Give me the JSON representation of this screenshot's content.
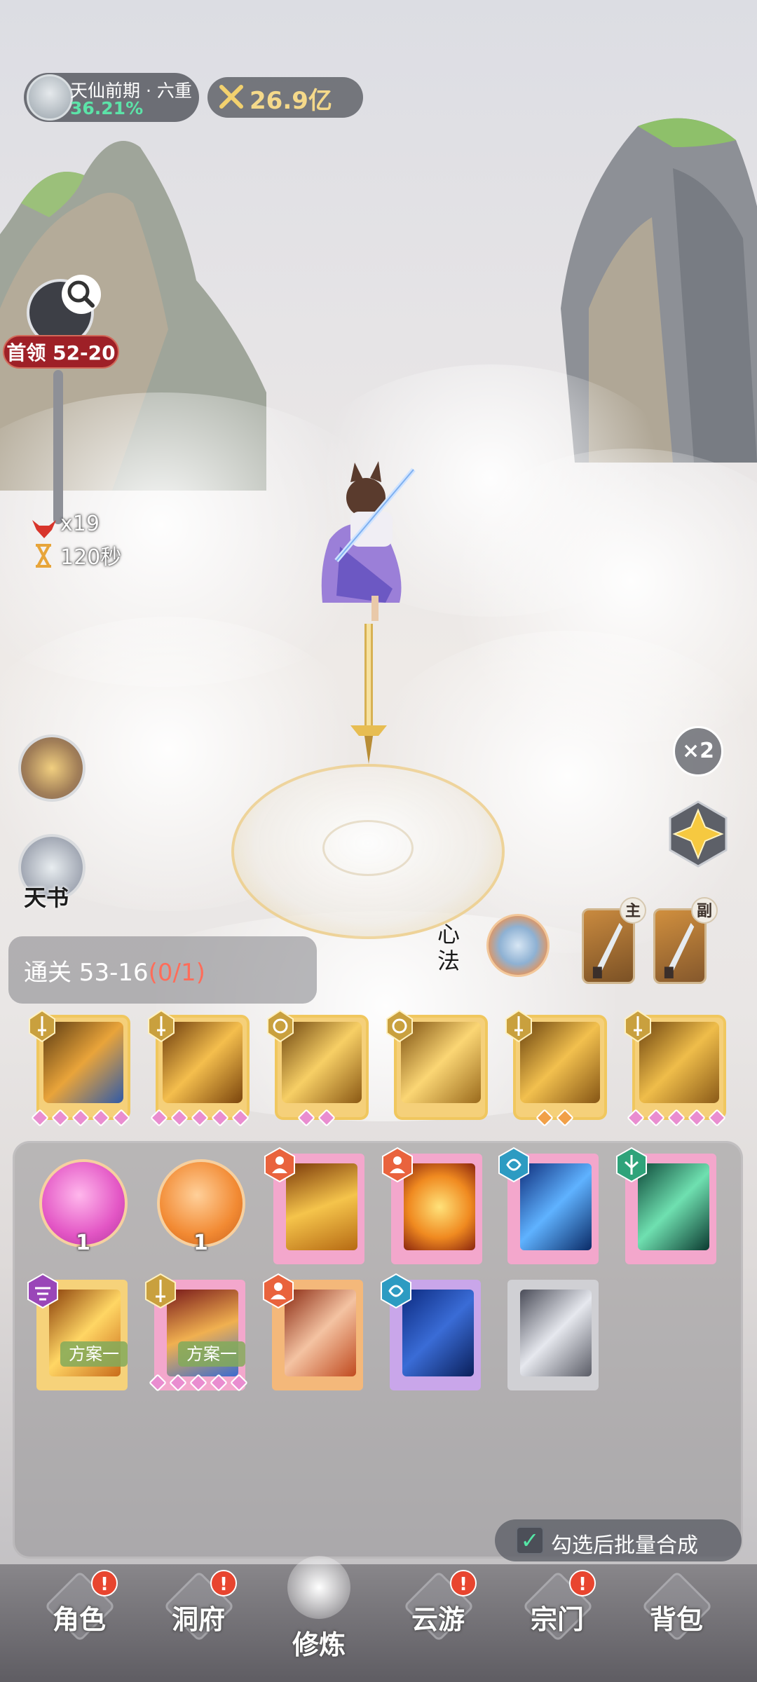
{
  "hud": {
    "realm": "天仙前期 · 六重",
    "realm_progress": "36.21%",
    "power": "26.9亿"
  },
  "boss": {
    "label": "首领 52-20",
    "enemy_count": "x19",
    "timer": "120秒"
  },
  "side": {
    "book_label": "天书",
    "speed": "×2"
  },
  "stage": {
    "prefix": "通关 53-16",
    "progress": "(0/1)",
    "xinfa_label": "心法"
  },
  "weapons": {
    "main_tag": "主",
    "sub_tag": "副"
  },
  "equipped_skills": [
    {
      "color": "#e8a83a",
      "gems": 5
    },
    {
      "color": "#d98a2a",
      "gems": 5
    },
    {
      "color": "#e6b348",
      "gems": 2
    },
    {
      "color": "#f0c35a",
      "gems": 0
    },
    {
      "color": "#e0a33c",
      "gems": 2
    },
    {
      "color": "#dca041",
      "gems": 5
    }
  ],
  "inventory": {
    "orb_counts": [
      "1",
      "1"
    ],
    "plan_tag": "方案一"
  },
  "batch": {
    "label": "勾选后批量合成",
    "check": "✓"
  },
  "nav": {
    "items": [
      {
        "label": "角色",
        "alert": "!"
      },
      {
        "label": "洞府",
        "alert": "!"
      },
      {
        "label": "修炼",
        "alert": ""
      },
      {
        "label": "云游",
        "alert": "!"
      },
      {
        "label": "宗门",
        "alert": "!"
      },
      {
        "label": "背包",
        "alert": ""
      }
    ]
  },
  "colors": {
    "accent_gold": "#f0c75e",
    "alert_red": "#e8452f",
    "progress_green": "#5ce3a8",
    "stage_progress_red": "#ff6d5a"
  }
}
